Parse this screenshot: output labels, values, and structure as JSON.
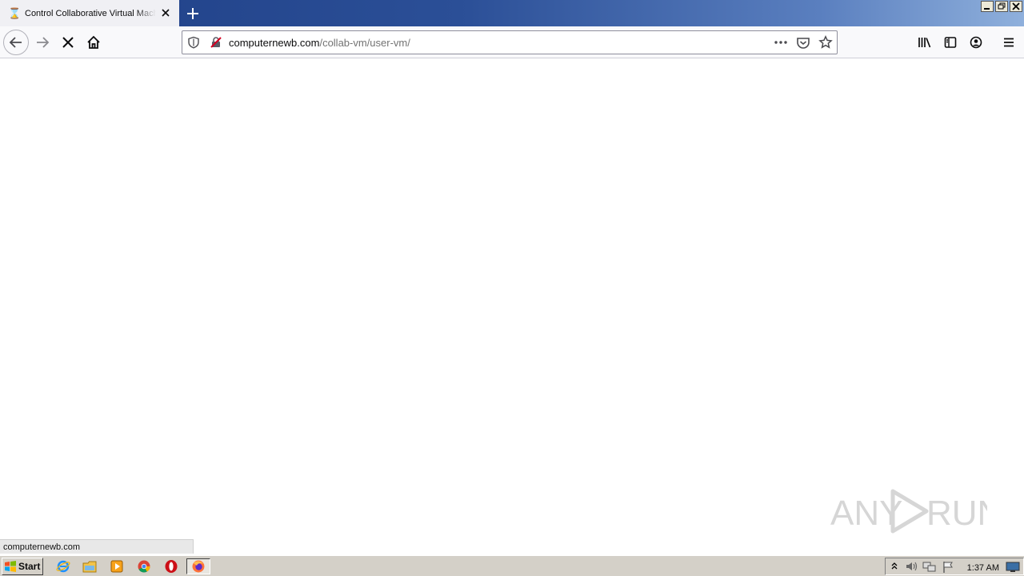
{
  "browser": {
    "tab": {
      "title": "Control Collaborative Virtual Machi",
      "favicon": "hourglass-icon"
    },
    "new_tab_icon": "plus-icon",
    "nav": {
      "back_icon": "arrow-left-icon",
      "forward_icon": "arrow-right-icon",
      "stop_icon": "x-icon",
      "home_icon": "home-icon"
    },
    "urlbar": {
      "host": "computernewb.com",
      "path": "/collab-vm/user-vm/",
      "security_icon": "shield-icon",
      "insecure_icon": "insecure-lock-icon",
      "page_actions_icon": "ellipsis-icon",
      "pocket_icon": "pocket-icon",
      "bookmark_icon": "star-icon"
    },
    "toolbar_right": [
      "library-icon",
      "sidebar-icon",
      "account-icon",
      "menu-icon"
    ],
    "status_text": "computernewb.com"
  },
  "watermark": {
    "text_left": "ANY",
    "text_right": "RUN"
  },
  "taskbar": {
    "start_label": "Start",
    "apps": [
      "ie-icon",
      "explorer-icon",
      "media-player-icon",
      "chrome-icon",
      "opera-icon",
      "firefox-icon"
    ],
    "tray_icons": [
      "chevron-up-icon",
      "speaker-icon",
      "network-icon",
      "flag-icon",
      "desktop-icon"
    ],
    "clock": "1:37 AM"
  },
  "colors": {
    "tabstrip_start": "#1f3f86",
    "tabstrip_end": "#8fb0dc",
    "insecure_red": "#d70022"
  }
}
